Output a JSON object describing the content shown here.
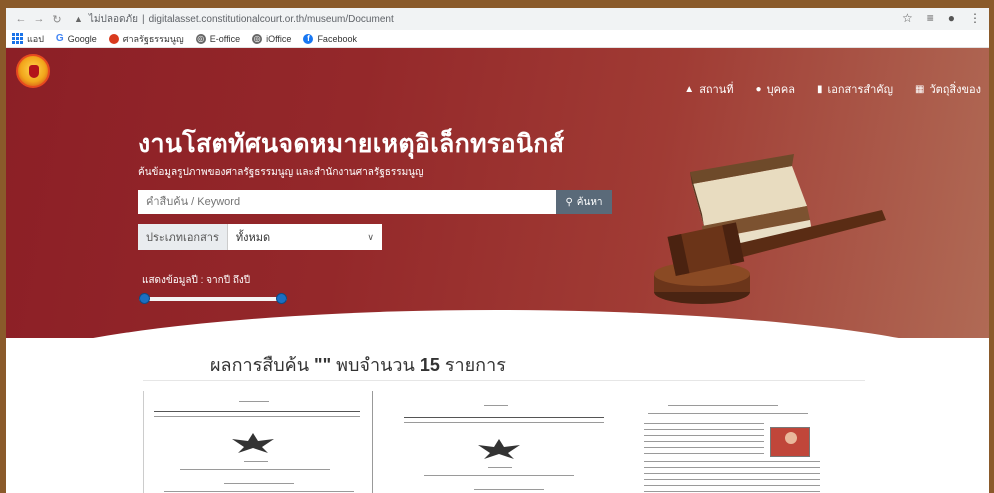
{
  "browser": {
    "url_security": "ไม่ปลอดภัย",
    "url": "digitalasset.constitutionalcourt.or.th/museum/Document",
    "bookmarks": [
      {
        "label": "แอป",
        "icon": "apps-grid-icon"
      },
      {
        "label": "Google",
        "icon": "google-icon"
      },
      {
        "label": "ศาลรัฐธรรมนูญ",
        "icon": "court-icon"
      },
      {
        "label": "E-office",
        "icon": "globe-icon"
      },
      {
        "label": "iOffice",
        "icon": "globe-icon"
      },
      {
        "label": "Facebook",
        "icon": "facebook-icon"
      }
    ]
  },
  "header": {
    "nav": [
      {
        "label": "สถานที่",
        "icon": "building-icon"
      },
      {
        "label": "บุคคล",
        "icon": "person-icon"
      },
      {
        "label": "เอกสารสำคัญ",
        "icon": "book-icon"
      },
      {
        "label": "วัตถุสิ่งของ",
        "icon": "objects-icon"
      }
    ]
  },
  "hero": {
    "title": "งานโสตทัศนจดหมายเหตุอิเล็กทรอนิกส์",
    "subtitle": "ค้นข้อมูลรูปภาพของศาลรัฐธรรมนูญ และสำนักงานศาลรัฐธรรมนูญ",
    "search_placeholder": "คำสืบค้น / Keyword",
    "search_button": "ค้นหา",
    "type_label": "ประเภทเอกสาร",
    "type_value": "ทั้งหมด",
    "year_label": "แสดงข้อมูลปี : จากปี ถึงปี",
    "year_range": {
      "min": 0,
      "max": 1
    }
  },
  "results": {
    "prefix": "ผลการสืบค้น",
    "query": "\"\"",
    "found": "พบจำนวน",
    "count": "15",
    "suffix": "รายการ"
  },
  "colors": {
    "hero_start": "#8c1f26",
    "hero_end": "#b06a55",
    "search_button": "#5a6a79",
    "slider_handle": "#1b6fc2"
  }
}
